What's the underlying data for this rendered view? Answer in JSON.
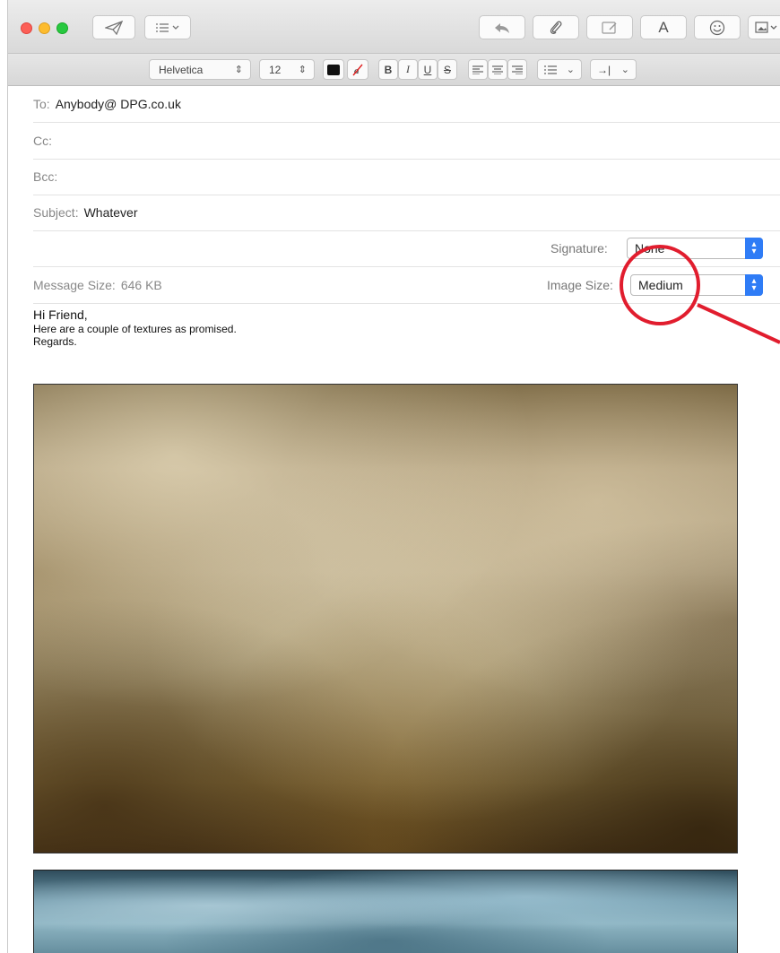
{
  "format": {
    "font": "Helvetica",
    "size": "12",
    "bold": "B",
    "italic": "I",
    "underline": "U",
    "strike": "S"
  },
  "toolbar": {
    "font_button": "A"
  },
  "headers": {
    "to_label": "To:",
    "to_value": "Anybody@ DPG.co.uk",
    "cc_label": "Cc:",
    "bcc_label": "Bcc:",
    "subject_label": "Subject:",
    "subject_value": "Whatever"
  },
  "options": {
    "signature_label": "Signature:",
    "signature_value": "None",
    "message_size_label": "Message Size:",
    "message_size_value": "646 KB",
    "image_size_label": "Image Size:",
    "image_size_value": "Medium"
  },
  "message": {
    "greeting": "Hi Friend,",
    "line1": "Here are a couple of textures as promised.",
    "line2": "Regards."
  },
  "colors": {
    "accent": "#2f7cf6",
    "annotation": "#e11d2e"
  }
}
